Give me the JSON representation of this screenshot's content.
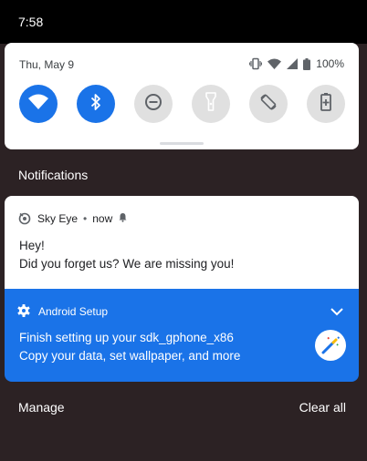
{
  "status_bar": {
    "time": "7:58"
  },
  "quick_settings": {
    "date": "Thu, May 9",
    "battery_percent": "100%",
    "tiles": [
      {
        "name": "wifi",
        "icon": "wifi-icon",
        "active": true
      },
      {
        "name": "bluetooth",
        "icon": "bluetooth-icon",
        "active": true
      },
      {
        "name": "do-not-disturb",
        "icon": "do-not-disturb-icon",
        "active": false
      },
      {
        "name": "flashlight",
        "icon": "flashlight-icon",
        "active": false
      },
      {
        "name": "auto-rotate",
        "icon": "auto-rotate-icon",
        "active": false
      },
      {
        "name": "battery-saver",
        "icon": "battery-saver-icon",
        "active": false
      }
    ]
  },
  "notifications": {
    "header": "Notifications",
    "items": [
      {
        "app_name": "Sky Eye",
        "separator": "•",
        "time": "now",
        "title": "Hey!",
        "text": "Did you forget us? We are missing you!"
      },
      {
        "app_name": "Android Setup",
        "title": "Finish setting up your sdk_gphone_x86",
        "text": "Copy your data, set wallpaper, and more"
      }
    ],
    "manage_label": "Manage",
    "clear_all_label": "Clear all"
  },
  "colors": {
    "accent": "#1a73e8",
    "background": "#2c2224",
    "tile_off": "#e0e0e0"
  }
}
